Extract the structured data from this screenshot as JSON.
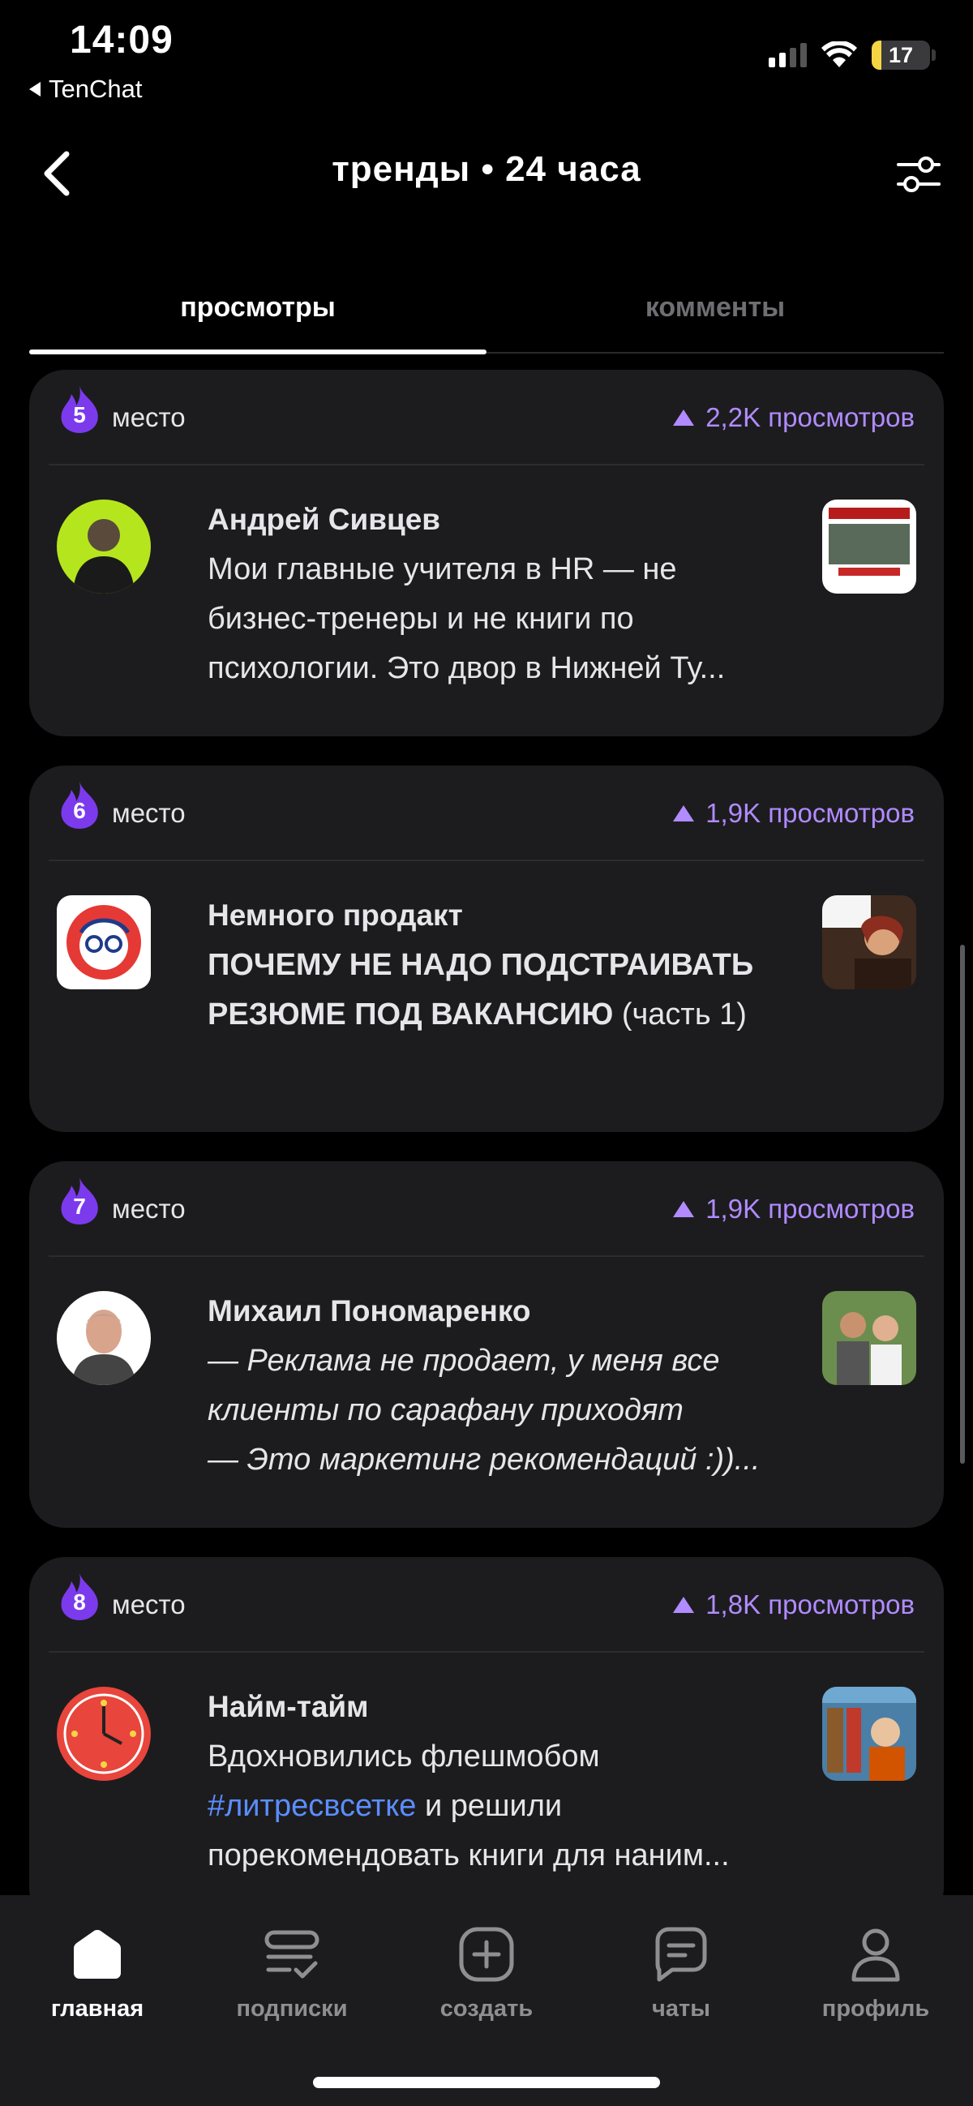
{
  "status_bar": {
    "time": "14:09",
    "back_app": "TenChat",
    "battery": "17",
    "battery_level": 0.17
  },
  "header": {
    "title": "тренды • 24 часа",
    "back_icon": "chevron-left-icon",
    "filter_icon": "sliders-icon"
  },
  "tabs": [
    {
      "label": "просмотры",
      "active": true
    },
    {
      "label": "комменты",
      "active": false
    }
  ],
  "place_label": "место",
  "posts": [
    {
      "rank": "5",
      "views": "2,2K просмотров",
      "author": "Андрей Сивцев",
      "excerpt": "Мои главные учителя в HR — не бизнес-тренеры и не книги по психологии. Это двор в Нижней Ту...",
      "avatar_bg": "#b5e61d"
    },
    {
      "rank": "6",
      "views": "1,9K просмотров",
      "author": "Немного продакт",
      "excerpt_bold": "ПОЧЕМУ НЕ НАДО ПОДСТРАИВАТЬ РЕЗЮМЕ ПОД ВАКАНСИЮ",
      "excerpt_rest": " (часть 1)",
      "avatar_bg": "#ffffff"
    },
    {
      "rank": "7",
      "views": "1,9K просмотров",
      "author": "Михаил Пономаренко",
      "excerpt_line1": "— Реклама не продает, у меня все клиенты по сарафану приходят",
      "excerpt_line2": "— Это маркетинг рекомендаций :))...",
      "avatar_bg": "#ffffff"
    },
    {
      "rank": "8",
      "views": "1,8K просмотров",
      "author": "Найм-тайм",
      "excerpt_pre": "Вдохновились флешмобом ",
      "hashtag": "#литресвсетке",
      "excerpt_post": " и решили порекомендовать книги для наним...",
      "avatar_bg": "#e8453c"
    }
  ],
  "bottom_nav": [
    {
      "label": "главная",
      "icon": "home-icon",
      "active": true
    },
    {
      "label": "подписки",
      "icon": "subscriptions-icon",
      "active": false
    },
    {
      "label": "создать",
      "icon": "plus-square-icon",
      "active": false
    },
    {
      "label": "чаты",
      "icon": "chat-icon",
      "active": false
    },
    {
      "label": "профиль",
      "icon": "profile-icon",
      "active": false
    }
  ],
  "colors": {
    "accent_purple": "#b18bff",
    "flame": "#7c3aed",
    "hashtag": "#5c8dff",
    "card_bg": "#1c1c1e"
  }
}
